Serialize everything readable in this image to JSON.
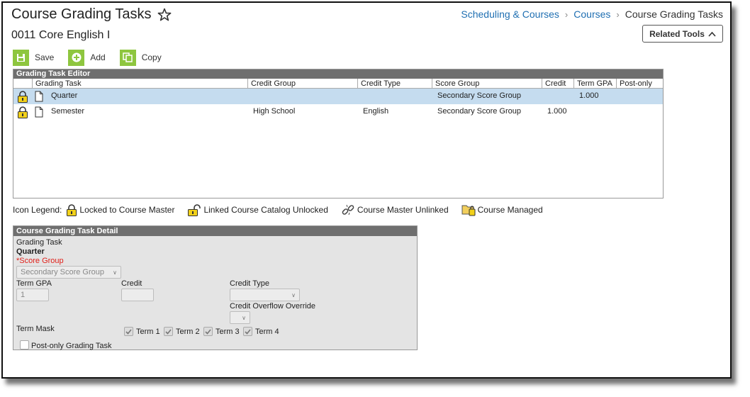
{
  "header": {
    "title": "Course Grading Tasks",
    "subtitle": "0011 Core English I",
    "breadcrumb": [
      "Scheduling & Courses",
      "Courses",
      "Course Grading Tasks"
    ],
    "related_tools": "Related Tools"
  },
  "toolbar": {
    "save": "Save",
    "add": "Add",
    "copy": "Copy"
  },
  "editor": {
    "title": "Grading Task Editor",
    "columns": [
      "Grading Task",
      "Credit Group",
      "Credit Type",
      "Score Group",
      "Credit",
      "Term GPA",
      "Post-only"
    ],
    "rows": [
      {
        "task": "Quarter",
        "credit_group": "",
        "credit_type": "",
        "score_group": "Secondary Score Group",
        "credit": "",
        "term_gpa": "1.000",
        "post_only": ""
      },
      {
        "task": "Semester",
        "credit_group": "High School",
        "credit_type": "English",
        "score_group": "Secondary Score Group",
        "credit": "1.000",
        "term_gpa": "",
        "post_only": ""
      }
    ]
  },
  "legend": {
    "label": "Icon Legend:",
    "items": [
      "Locked to Course Master",
      "Linked Course Catalog Unlocked",
      "Course Master Unlinked",
      "Course Managed"
    ]
  },
  "detail": {
    "title": "Course Grading Task Detail",
    "grading_task_label": "Grading Task",
    "grading_task_value": "Quarter",
    "score_group_label": "*Score Group",
    "score_group_value": "Secondary Score Group",
    "term_gpa_label": "Term GPA",
    "term_gpa_value": "1",
    "credit_label": "Credit",
    "credit_value": "",
    "credit_type_label": "Credit Type",
    "credit_type_value": "",
    "overflow_label": "Credit Overflow Override",
    "term_mask_label": "Term Mask",
    "terms": [
      "Term 1",
      "Term 2",
      "Term 3",
      "Term 4"
    ],
    "post_only_label": "Post-only Grading Task"
  },
  "colors": {
    "accent_green": "#8ec63f",
    "link_blue": "#1f6fb2",
    "selected_row": "#c5dcef",
    "section_header": "#6f6f6f"
  }
}
